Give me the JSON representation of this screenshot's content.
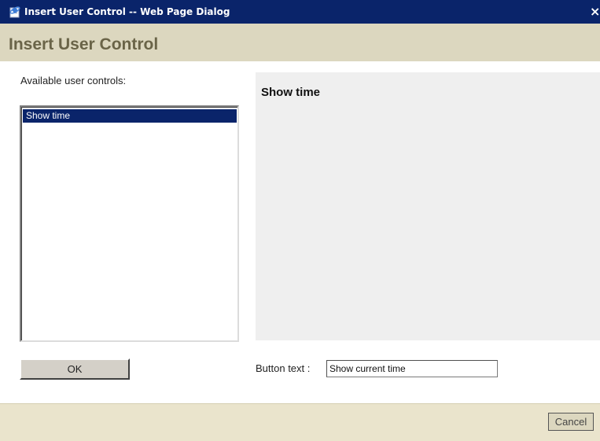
{
  "window": {
    "title": "Insert User Control -- Web Page Dialog",
    "close_glyph": "×",
    "icon": "ie-page-icon"
  },
  "dialog": {
    "heading": "Insert User Control"
  },
  "controls_list": {
    "label": "Available user controls:",
    "items": [
      {
        "label": "Show time",
        "selected": true
      }
    ]
  },
  "preview": {
    "title": "Show time"
  },
  "button_text": {
    "label": "Button text :",
    "value": "Show current time"
  },
  "actions": {
    "ok_label": "OK",
    "cancel_label": "Cancel"
  },
  "colors": {
    "titlebar": "#0a246a",
    "selection": "#0a246a",
    "header_band": "#dcd7bf",
    "footer_band": "#eae4cc",
    "preview_bg": "#efefef"
  }
}
